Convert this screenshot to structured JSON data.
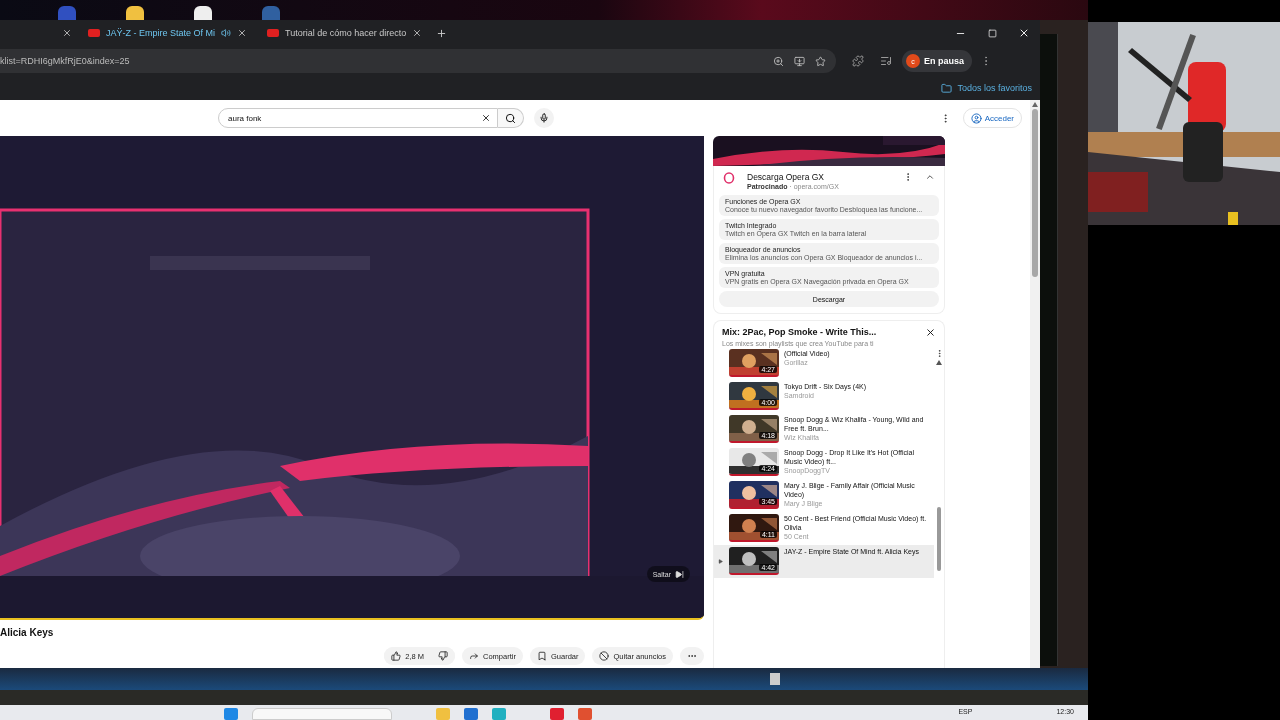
{
  "tabs": [
    {
      "playing": false
    },
    {
      "title": "JAŸ-Z - Empire State Of Mi",
      "playing": true
    },
    {
      "title": "Tutorial de cómo hacer directo",
      "playing": false
    }
  ],
  "address": {
    "value": "klist=RDHI6gMkfRjE0&index=25"
  },
  "profile": {
    "initial": "c",
    "label": "En pausa"
  },
  "bookmarks": {
    "label": "Todos los favoritos"
  },
  "search": {
    "value": "aura fonk"
  },
  "sign_in": "Acceder",
  "video": {
    "skip": "Saltar",
    "title": "Alicia Keys",
    "likes": "2,8 M",
    "actions": [
      "Compartir",
      "Guardar",
      "Quitar anuncios"
    ]
  },
  "ad": {
    "title": "Descarga Opera GX",
    "sponsor": "Patrocinado",
    "domain": " · opera.com/GX",
    "features": [
      {
        "title": "Funciones de Opera GX",
        "text": "Conoce tu nuevo navegador favorito Desbloquea las funcione..."
      },
      {
        "title": "Twitch Integrado",
        "text": "Twitch en Opera GX Twitch en la barra lateral"
      },
      {
        "title": "Bloqueador de anuncios",
        "text": "Elimina los anuncios con Opera GX Bloqueador de anuncios i..."
      },
      {
        "title": "VPN gratuita",
        "text": "VPN gratis en Opera GX Navegación privada en Opera GX"
      }
    ],
    "button": "Descargar"
  },
  "playlist": {
    "title": "Mix: 2Pac, Pop Smoke - Write This...",
    "subtitle": "Los mixes son playlists que crea YouTube para ti",
    "items": [
      {
        "title": "(Official Video)",
        "channel": "Gorillaz",
        "duration": "4:27",
        "selected": false
      },
      {
        "title": "Tokyo Drift - Six Days (4K)",
        "channel": "Samdroid",
        "duration": "4:00",
        "selected": false
      },
      {
        "title": "Snoop Dogg & Wiz Khalifa - Young, Wild and Free ft. Brun...",
        "channel": "Wiz Khalifa",
        "duration": "4:18",
        "selected": false
      },
      {
        "title": "Snoop Dogg - Drop It Like It's Hot (Official Music Video) ft...",
        "channel": "SnoopDoggTV",
        "duration": "4:24",
        "selected": false
      },
      {
        "title": "Mary J. Blige - Family Affair (Official Music Video)",
        "channel": "Mary J Blige",
        "duration": "3:45",
        "selected": false
      },
      {
        "title": "50 Cent - Best Friend (Official Music Video) ft. Olivia",
        "channel": "50 Cent",
        "duration": "4:11",
        "selected": false
      },
      {
        "title": "JAY-Z - Empire State Of Mind ft. Alicia Keys",
        "duration": "4:42",
        "selected": true
      }
    ]
  },
  "taskbar": {
    "language": "ESP",
    "time": "12:30"
  }
}
